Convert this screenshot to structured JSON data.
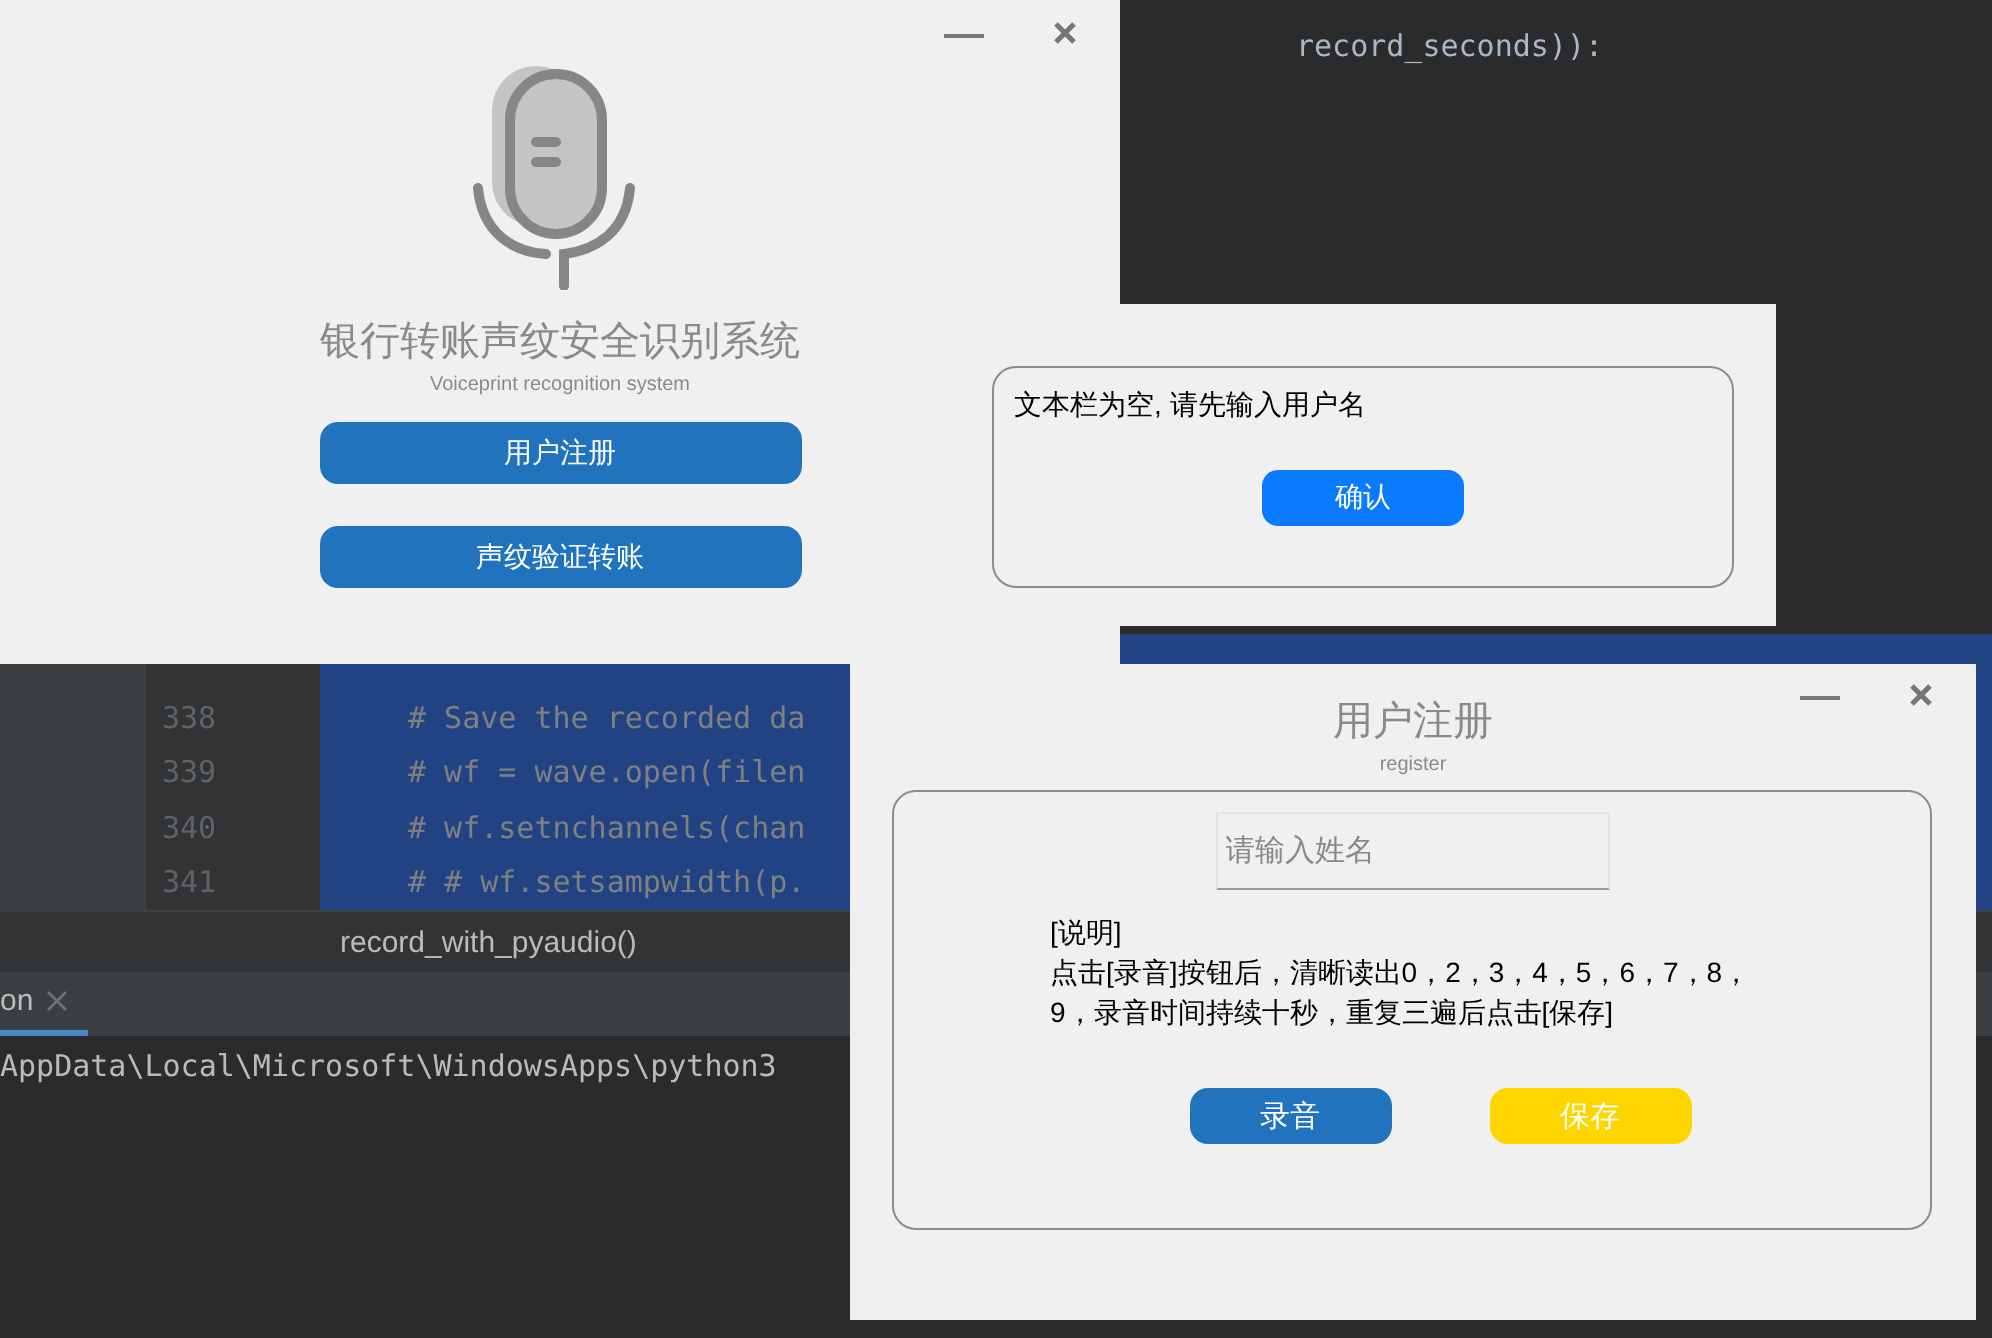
{
  "ide": {
    "top_code_line": "record_seconds)):",
    "code_lines": [
      {
        "number": "338",
        "text": "# Save the recorded da",
        "selected": true
      },
      {
        "number": "339",
        "text": "# wf = wave.open(filen",
        "selected": true
      },
      {
        "number": "340",
        "text": "# wf.setnchannels(chan",
        "selected": true
      },
      {
        "number": "341",
        "text": "# # wf.setsampwidth(p.",
        "selected": true
      }
    ],
    "breadcrumb": "record_with_pyaudio()",
    "run_tabs": [
      {
        "label": "on",
        "selected": true
      }
    ],
    "console_line": "AppData\\Local\\Microsoft\\WindowsApps\\python3"
  },
  "main_window": {
    "title": "银行转账声纹安全识别系统",
    "subtitle": "Voiceprint recognition system",
    "buttons": [
      "用户注册",
      "声纹验证转账"
    ]
  },
  "alert_dialog": {
    "message": "文本栏为空, 请先输入用户名",
    "button": "确认"
  },
  "register_window": {
    "title": "用户注册",
    "subtitle": "register",
    "name_field": {
      "placeholder": "请输入姓名"
    },
    "instructions_heading": "[说明]",
    "instructions": "点击[录音]按钮后，清晰读出0，2，3，4，5，6，7，8，9，录音时间持续十秒，重复三遍后点击[保存]",
    "buttons": [
      {
        "label": "录音",
        "kind": "primary"
      },
      {
        "label": "保存",
        "kind": "warning"
      }
    ]
  }
}
